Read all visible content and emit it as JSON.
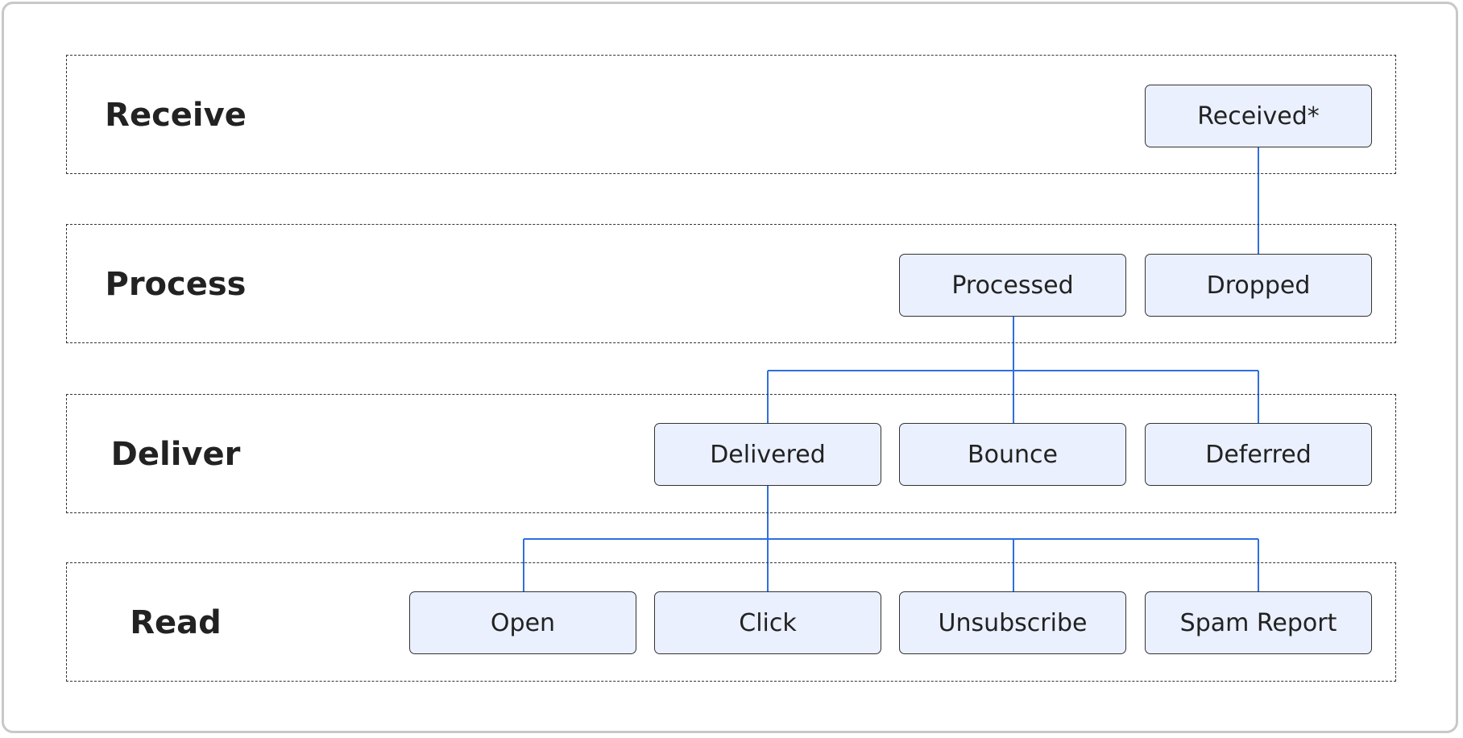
{
  "colors": {
    "connector": "#2f6fe0",
    "node_fill": "#eaf0fd",
    "node_border": "#333333",
    "lane_border": "#333333"
  },
  "lanes": [
    {
      "label": "Receive",
      "nodes": [
        "Received*"
      ]
    },
    {
      "label": "Process",
      "nodes": [
        "Processed",
        "Dropped"
      ]
    },
    {
      "label": "Deliver",
      "nodes": [
        "Delivered",
        "Bounce",
        "Deferred"
      ]
    },
    {
      "label": "Read",
      "nodes": [
        "Open",
        "Click",
        "Unsubscribe",
        "Spam Report"
      ]
    }
  ],
  "edges": [
    {
      "from": "Received*",
      "to": "Dropped"
    },
    {
      "from": "Processed",
      "to": "Delivered"
    },
    {
      "from": "Processed",
      "to": "Bounce"
    },
    {
      "from": "Processed",
      "to": "Deferred"
    },
    {
      "from": "Delivered",
      "to": "Open"
    },
    {
      "from": "Delivered",
      "to": "Click"
    },
    {
      "from": "Delivered",
      "to": "Unsubscribe"
    },
    {
      "from": "Delivered",
      "to": "Spam Report"
    }
  ]
}
